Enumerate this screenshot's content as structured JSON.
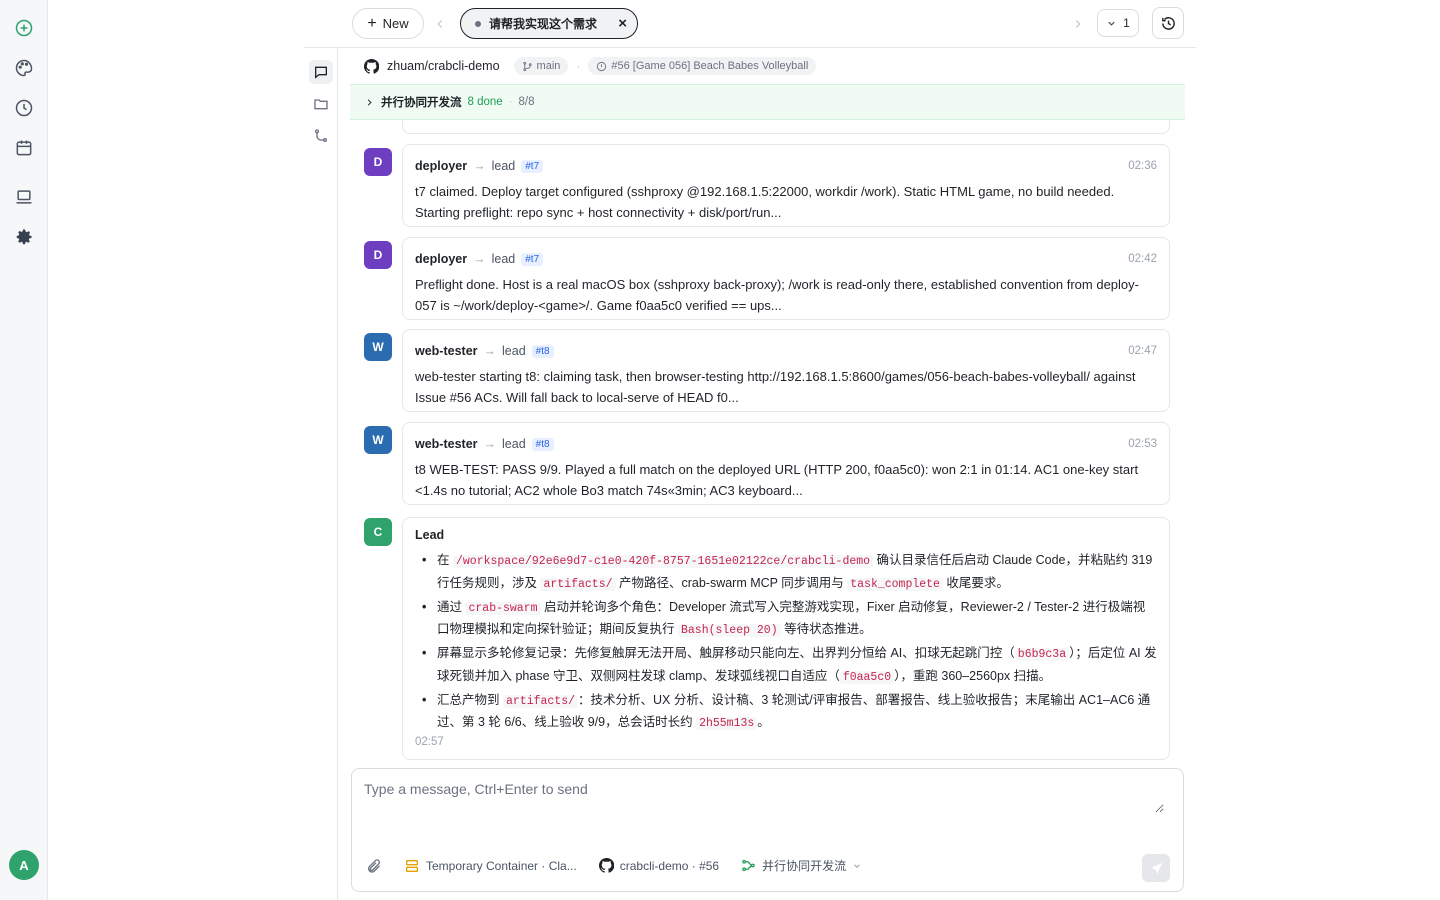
{
  "rail": {
    "items": [
      "new-chat-icon",
      "palette-icon",
      "history-icon",
      "calendar-icon",
      "laptop-icon",
      "gear-icon"
    ],
    "user_initial": "A"
  },
  "topbar": {
    "new_label": "New",
    "active_tab": "请帮我实现这个需求",
    "close_glyph": "×",
    "count": "1"
  },
  "repo": {
    "name": "zhuam/crabcli-demo",
    "branch": "main",
    "issue": "#56 [Game 056] Beach Babes Volleyball"
  },
  "swarm": {
    "title": "并行协同开发流",
    "done": "8 done",
    "ratio": "8/8"
  },
  "messages": [
    {
      "initial": "D",
      "sender": "deployer",
      "receiver": "lead",
      "tag": "#t7",
      "time": "02:36",
      "body": "t7 claimed. Deploy target configured (sshproxy @192.168.1.5:22000, workdir /work). Static HTML game, no build needed. Starting preflight: repo sync + host connectivity + disk/port/run..."
    },
    {
      "initial": "D",
      "sender": "deployer",
      "receiver": "lead",
      "tag": "#t7",
      "time": "02:42",
      "body": "Preflight done. Host is a real macOS box (sshproxy back-proxy); /work is read-only there, established convention from deploy-057 is ~/work/deploy-<game>/. Game f0aa5c0 verified == ups..."
    },
    {
      "initial": "W",
      "sender": "web-tester",
      "receiver": "lead",
      "tag": "#t8",
      "time": "02:47",
      "body": "web-tester starting t8: claiming task, then browser-testing http://192.168.1.5:8600/games/056-beach-babes-volleyball/ against Issue #56 ACs. Will fall back to local-serve of HEAD f0..."
    },
    {
      "initial": "W",
      "sender": "web-tester",
      "receiver": "lead",
      "tag": "#t8",
      "time": "02:53",
      "body": "t8 WEB-TEST: PASS 9/9. Played a full match on the deployed URL (HTTP 200, f0aa5c0): won 2:1 in 01:14. AC1 one-key start <1.4s no tutorial; AC2 whole Bo3 match 74s«3min; AC3 keyboard..."
    }
  ],
  "lead": {
    "initial": "C",
    "title": "Lead",
    "time": "02:57",
    "b1": {
      "t1": "在 ",
      "c1": "/workspace/92e6e9d7-c1e0-420f-8757-1651e02122ce/crabcli-demo",
      "t2": " 确认目录信任后启动 Claude Code，并粘贴约 319 行任务规则，涉及 ",
      "c2": "artifacts/",
      "t3": " 产物路径、crab-swarm MCP 同步调用与 ",
      "c3": "task_complete",
      "t4": " 收尾要求。"
    },
    "b2": {
      "t1": "通过 ",
      "c1": "crab-swarm",
      "t2": " 启动并轮询多个角色：Developer 流式写入完整游戏实现，Fixer 启动修复，Reviewer-2 / Tester-2 进行极端视口物理模拟和定向探针验证；期间反复执行 ",
      "c2": "Bash(sleep 20)",
      "t3": " 等待状态推进。"
    },
    "b3": {
      "t1": "屏幕显示多轮修复记录：先修复触屏无法开局、触屏移动只能向左、出界判分恒给 AI、扣球无起跳门控（",
      "c1": "b6b9c3a",
      "t2": "）；后定位 AI 发球死锁并加入 phase 守卫、双侧网柱发球 clamp、发球弧线视口自适应（",
      "c2": "f0aa5c0",
      "t3": "），重跑 360–2560px 扫描。"
    },
    "b4": {
      "t1": "汇总产物到 ",
      "c1": "artifacts/",
      "t2": "：技术分析、UX 分析、设计稿、3 轮测试/评审报告、部署报告、线上验收报告；末尾输出 AC1–AC6 通过、第 3 轮 6/6、线上验收 9/9，总会话时长约 ",
      "c2": "2h55m13s",
      "t3": "。"
    }
  },
  "composer": {
    "placeholder": "Type a message, Ctrl+Enter to send",
    "container": "Temporary Container · Cla...",
    "repo": "crabcli-demo · #56",
    "workflow": "并行协同开发流"
  }
}
